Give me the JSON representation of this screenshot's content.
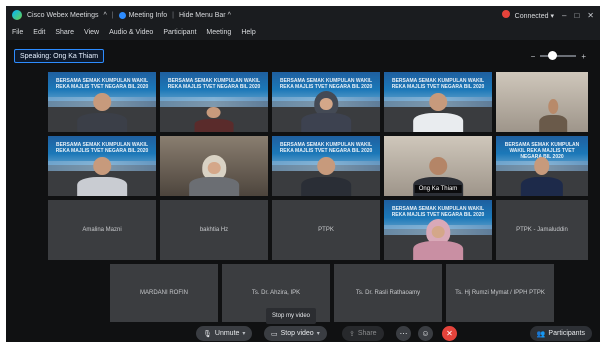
{
  "titlebar": {
    "app_title": "Cisco Webex Meetings",
    "meeting_info": "Meeting Info",
    "hide_menu_bar": "Hide Menu Bar",
    "connected": "Connected",
    "connected_chevron": "▾",
    "hide_chevron": "^"
  },
  "menu": [
    "File",
    "Edit",
    "Share",
    "View",
    "Audio & Video",
    "Participant",
    "Meeting",
    "Help"
  ],
  "speaking_label": "Speaking: Ong Ka Thiam",
  "zoom": {
    "minus": "−",
    "plus": "+",
    "level": 0.3
  },
  "tiles": {
    "r1": [
      "",
      "",
      "",
      "",
      ""
    ],
    "r2": [
      "",
      "",
      "",
      "Ong Ka Thiam",
      ""
    ],
    "r3": [
      "Amalina Mazni",
      "bakhtia Hz",
      "PTPK",
      "",
      "PTPK - Jamaluddin"
    ],
    "r4": [
      "MARDANI ROFIN",
      "Ts. Dr. Ahzira, IPK",
      "Ts. Dr. Rasli Rathaoamy",
      "Ts. Hj Rumzi Mymat / IPPH PTPK"
    ]
  },
  "banner_text": "BERSAMA SEMAK KUMPULAN WAKIL REKA MAJLIS TVET NEGARA BIL 2020",
  "tooltip": "Stop my video",
  "controls": {
    "unmute": "Unmute",
    "stop_video": "Stop video",
    "share": "Share",
    "participants": "Participants"
  },
  "colors": {
    "end_red": "#e5433b",
    "accent_blue": "#2d8cff"
  }
}
